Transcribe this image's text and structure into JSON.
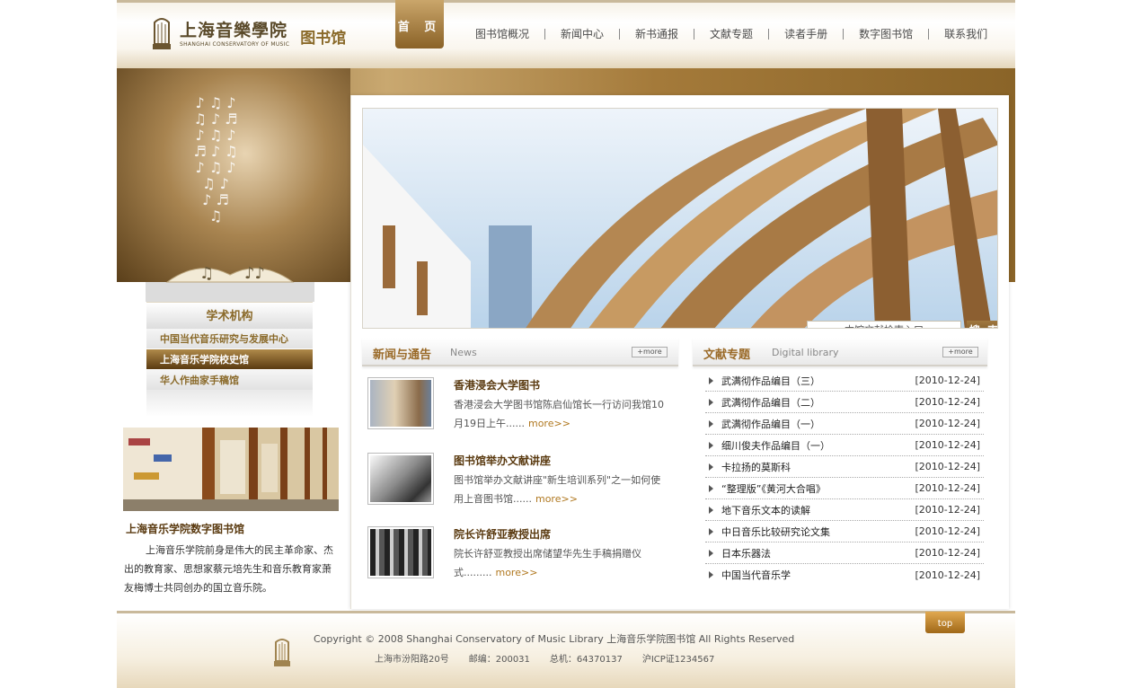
{
  "header": {
    "logo_cn": "上海音樂學院",
    "logo_en": "SHANGHAI CONSERVATORY OF MUSIC",
    "logo_lib": "图书馆",
    "home_tab": "首 页",
    "nav": [
      "图书馆概况",
      "新闻中心",
      "新书通报",
      "文献专题",
      "读者手册",
      "数字图书馆",
      "联系我们"
    ]
  },
  "sidebar": {
    "menu_title": "学术机构",
    "items": [
      "中国当代音乐研究与发展中心",
      "上海音乐学院校史馆",
      "华人作曲家手稿馆"
    ],
    "active_index": 1,
    "dl_title": "上海音乐学院数字图书馆",
    "dl_text": "上海音乐学院前身是伟大的民主革命家、杰出的教育家、思想家蔡元培先生和音乐教育家萧友梅博士共同创办的国立音乐院。"
  },
  "search": {
    "placeholder": "本馆文献检索入口",
    "button": "搜 索"
  },
  "news": {
    "title": "新闻与通告",
    "title_en": "News",
    "more": "+more",
    "items": [
      {
        "title": "香港浸会大学图书",
        "body": "香港浸会大学图书馆陈启仙馆长一行访问我馆10月19日上午......",
        "more": "more>>"
      },
      {
        "title": "图书馆举办文献讲座",
        "body": "图书馆举办文献讲座\"新生培训系列\"之一如何使用上音图书馆......",
        "more": "more>>"
      },
      {
        "title": "院长许舒亚教授出席",
        "body": "院长许舒亚教授出席储望华先生手稿捐赠仪式.........",
        "more": "more>>"
      }
    ]
  },
  "docs": {
    "title": "文献专题",
    "title_en": "Digital library",
    "more": "+more",
    "items": [
      {
        "title": "武满彻作品编目（三）",
        "date": "[2010-12-24]"
      },
      {
        "title": "武满彻作品编目（二）",
        "date": "[2010-12-24]"
      },
      {
        "title": "武满彻作品编目（一）",
        "date": "[2010-12-24]"
      },
      {
        "title": "细川俊夫作品编目（一）",
        "date": "[2010-12-24]"
      },
      {
        "title": "卡拉扬的莫斯科",
        "date": "[2010-12-24]"
      },
      {
        "title": "“整理版”《黄河大合唱》",
        "date": "[2010-12-24]"
      },
      {
        "title": "地下音乐文本的读解",
        "date": "[2010-12-24]"
      },
      {
        "title": "中日音乐比较研究论文集",
        "date": "[2010-12-24]"
      },
      {
        "title": "日本乐器法",
        "date": "[2010-12-24]"
      },
      {
        "title": "中国当代音乐学",
        "date": "[2010-12-24]"
      }
    ]
  },
  "footer": {
    "copyright": "Copyright © 2008 Shanghai Conservatory of Music Library 上海音乐学院图书馆    All Rights Reserved",
    "address": "上海市汾阳路20号",
    "postcode": "邮编：200031",
    "phone": "总机：64370137",
    "icp": "沪ICP证1234567",
    "top": "top"
  },
  "colors": {
    "brand_brown": "#8a6a2a",
    "accent_gold": "#b07820"
  }
}
